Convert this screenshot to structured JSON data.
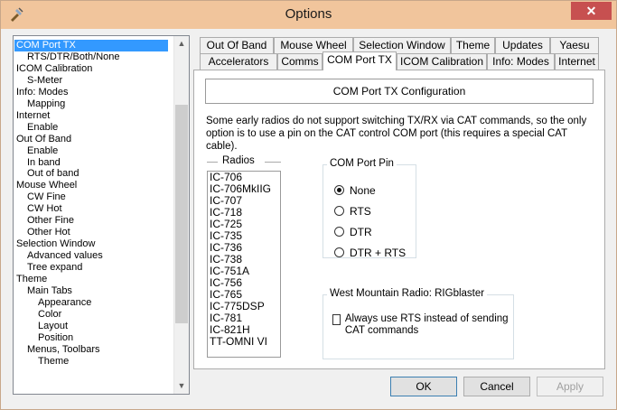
{
  "window": {
    "title": "Options",
    "close_glyph": "✕"
  },
  "tree": {
    "items": [
      {
        "label": "COM Port TX",
        "level": 0,
        "selected": true
      },
      {
        "label": "RTS/DTR/Both/None",
        "level": 1
      },
      {
        "label": "ICOM Calibration",
        "level": 0
      },
      {
        "label": "S-Meter",
        "level": 1
      },
      {
        "label": "Info: Modes",
        "level": 0
      },
      {
        "label": "Mapping",
        "level": 1
      },
      {
        "label": "Internet",
        "level": 0
      },
      {
        "label": "Enable",
        "level": 1
      },
      {
        "label": "Out Of Band",
        "level": 0
      },
      {
        "label": "Enable",
        "level": 1
      },
      {
        "label": "In band",
        "level": 1
      },
      {
        "label": "Out of band",
        "level": 1
      },
      {
        "label": "Mouse Wheel",
        "level": 0
      },
      {
        "label": "CW Fine",
        "level": 1
      },
      {
        "label": "CW Hot",
        "level": 1
      },
      {
        "label": "Other Fine",
        "level": 1
      },
      {
        "label": "Other Hot",
        "level": 1
      },
      {
        "label": "Selection Window",
        "level": 0
      },
      {
        "label": "Advanced values",
        "level": 1
      },
      {
        "label": "Tree expand",
        "level": 1
      },
      {
        "label": "Theme",
        "level": 0
      },
      {
        "label": "Main Tabs",
        "level": 1
      },
      {
        "label": "Appearance",
        "level": 2
      },
      {
        "label": "Color",
        "level": 2
      },
      {
        "label": "Layout",
        "level": 2
      },
      {
        "label": "Position",
        "level": 2
      },
      {
        "label": "Menus, Toolbars",
        "level": 1
      },
      {
        "label": "Theme",
        "level": 2
      }
    ]
  },
  "tabs": {
    "row1": [
      "Out Of Band",
      "Mouse Wheel",
      "Selection Window",
      "Theme",
      "Updates",
      "Yaesu"
    ],
    "row2": [
      "Accelerators",
      "Comms",
      "COM Port TX",
      "ICOM Calibration",
      "Info: Modes",
      "Internet"
    ],
    "active": "COM Port TX"
  },
  "panel": {
    "header": "COM Port TX Configuration",
    "description": "Some early radios do not support switching TX/RX via CAT commands, so the only option is to use a pin on the CAT control COM port (this requires a special CAT cable).",
    "radios_title": "Radios",
    "radios": [
      "IC-706",
      "IC-706MkIIG",
      "IC-707",
      "IC-718",
      "IC-725",
      "IC-735",
      "IC-736",
      "IC-738",
      "IC-751A",
      "IC-756",
      "IC-765",
      "IC-775DSP",
      "IC-781",
      "IC-821H",
      "TT-OMNI VI"
    ],
    "com_port_pin": {
      "title": "COM Port Pin",
      "options": [
        "None",
        "RTS",
        "DTR",
        "DTR + RTS"
      ],
      "selected": "None"
    },
    "rigblaster": {
      "title": "West Mountain Radio: RIGblaster",
      "checkbox_label": "Always use RTS instead of sending CAT commands",
      "checked": false
    }
  },
  "buttons": {
    "ok": "OK",
    "cancel": "Cancel",
    "apply": "Apply"
  },
  "colors": {
    "titlebar": "#f1c59c",
    "selection": "#3399ff",
    "close": "#c75050"
  }
}
